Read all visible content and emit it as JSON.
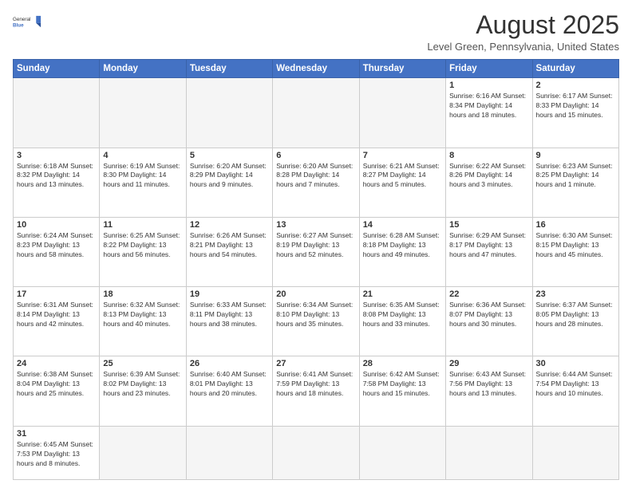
{
  "header": {
    "logo_general": "General",
    "logo_blue": "Blue",
    "month_year": "August 2025",
    "location": "Level Green, Pennsylvania, United States"
  },
  "days_of_week": [
    "Sunday",
    "Monday",
    "Tuesday",
    "Wednesday",
    "Thursday",
    "Friday",
    "Saturday"
  ],
  "weeks": [
    [
      {
        "day": "",
        "info": ""
      },
      {
        "day": "",
        "info": ""
      },
      {
        "day": "",
        "info": ""
      },
      {
        "day": "",
        "info": ""
      },
      {
        "day": "",
        "info": ""
      },
      {
        "day": "1",
        "info": "Sunrise: 6:16 AM\nSunset: 8:34 PM\nDaylight: 14 hours and 18 minutes."
      },
      {
        "day": "2",
        "info": "Sunrise: 6:17 AM\nSunset: 8:33 PM\nDaylight: 14 hours and 15 minutes."
      }
    ],
    [
      {
        "day": "3",
        "info": "Sunrise: 6:18 AM\nSunset: 8:32 PM\nDaylight: 14 hours and 13 minutes."
      },
      {
        "day": "4",
        "info": "Sunrise: 6:19 AM\nSunset: 8:30 PM\nDaylight: 14 hours and 11 minutes."
      },
      {
        "day": "5",
        "info": "Sunrise: 6:20 AM\nSunset: 8:29 PM\nDaylight: 14 hours and 9 minutes."
      },
      {
        "day": "6",
        "info": "Sunrise: 6:20 AM\nSunset: 8:28 PM\nDaylight: 14 hours and 7 minutes."
      },
      {
        "day": "7",
        "info": "Sunrise: 6:21 AM\nSunset: 8:27 PM\nDaylight: 14 hours and 5 minutes."
      },
      {
        "day": "8",
        "info": "Sunrise: 6:22 AM\nSunset: 8:26 PM\nDaylight: 14 hours and 3 minutes."
      },
      {
        "day": "9",
        "info": "Sunrise: 6:23 AM\nSunset: 8:25 PM\nDaylight: 14 hours and 1 minute."
      }
    ],
    [
      {
        "day": "10",
        "info": "Sunrise: 6:24 AM\nSunset: 8:23 PM\nDaylight: 13 hours and 58 minutes."
      },
      {
        "day": "11",
        "info": "Sunrise: 6:25 AM\nSunset: 8:22 PM\nDaylight: 13 hours and 56 minutes."
      },
      {
        "day": "12",
        "info": "Sunrise: 6:26 AM\nSunset: 8:21 PM\nDaylight: 13 hours and 54 minutes."
      },
      {
        "day": "13",
        "info": "Sunrise: 6:27 AM\nSunset: 8:19 PM\nDaylight: 13 hours and 52 minutes."
      },
      {
        "day": "14",
        "info": "Sunrise: 6:28 AM\nSunset: 8:18 PM\nDaylight: 13 hours and 49 minutes."
      },
      {
        "day": "15",
        "info": "Sunrise: 6:29 AM\nSunset: 8:17 PM\nDaylight: 13 hours and 47 minutes."
      },
      {
        "day": "16",
        "info": "Sunrise: 6:30 AM\nSunset: 8:15 PM\nDaylight: 13 hours and 45 minutes."
      }
    ],
    [
      {
        "day": "17",
        "info": "Sunrise: 6:31 AM\nSunset: 8:14 PM\nDaylight: 13 hours and 42 minutes."
      },
      {
        "day": "18",
        "info": "Sunrise: 6:32 AM\nSunset: 8:13 PM\nDaylight: 13 hours and 40 minutes."
      },
      {
        "day": "19",
        "info": "Sunrise: 6:33 AM\nSunset: 8:11 PM\nDaylight: 13 hours and 38 minutes."
      },
      {
        "day": "20",
        "info": "Sunrise: 6:34 AM\nSunset: 8:10 PM\nDaylight: 13 hours and 35 minutes."
      },
      {
        "day": "21",
        "info": "Sunrise: 6:35 AM\nSunset: 8:08 PM\nDaylight: 13 hours and 33 minutes."
      },
      {
        "day": "22",
        "info": "Sunrise: 6:36 AM\nSunset: 8:07 PM\nDaylight: 13 hours and 30 minutes."
      },
      {
        "day": "23",
        "info": "Sunrise: 6:37 AM\nSunset: 8:05 PM\nDaylight: 13 hours and 28 minutes."
      }
    ],
    [
      {
        "day": "24",
        "info": "Sunrise: 6:38 AM\nSunset: 8:04 PM\nDaylight: 13 hours and 25 minutes."
      },
      {
        "day": "25",
        "info": "Sunrise: 6:39 AM\nSunset: 8:02 PM\nDaylight: 13 hours and 23 minutes."
      },
      {
        "day": "26",
        "info": "Sunrise: 6:40 AM\nSunset: 8:01 PM\nDaylight: 13 hours and 20 minutes."
      },
      {
        "day": "27",
        "info": "Sunrise: 6:41 AM\nSunset: 7:59 PM\nDaylight: 13 hours and 18 minutes."
      },
      {
        "day": "28",
        "info": "Sunrise: 6:42 AM\nSunset: 7:58 PM\nDaylight: 13 hours and 15 minutes."
      },
      {
        "day": "29",
        "info": "Sunrise: 6:43 AM\nSunset: 7:56 PM\nDaylight: 13 hours and 13 minutes."
      },
      {
        "day": "30",
        "info": "Sunrise: 6:44 AM\nSunset: 7:54 PM\nDaylight: 13 hours and 10 minutes."
      }
    ],
    [
      {
        "day": "31",
        "info": "Sunrise: 6:45 AM\nSunset: 7:53 PM\nDaylight: 13 hours and 8 minutes."
      },
      {
        "day": "",
        "info": ""
      },
      {
        "day": "",
        "info": ""
      },
      {
        "day": "",
        "info": ""
      },
      {
        "day": "",
        "info": ""
      },
      {
        "day": "",
        "info": ""
      },
      {
        "day": "",
        "info": ""
      }
    ]
  ]
}
